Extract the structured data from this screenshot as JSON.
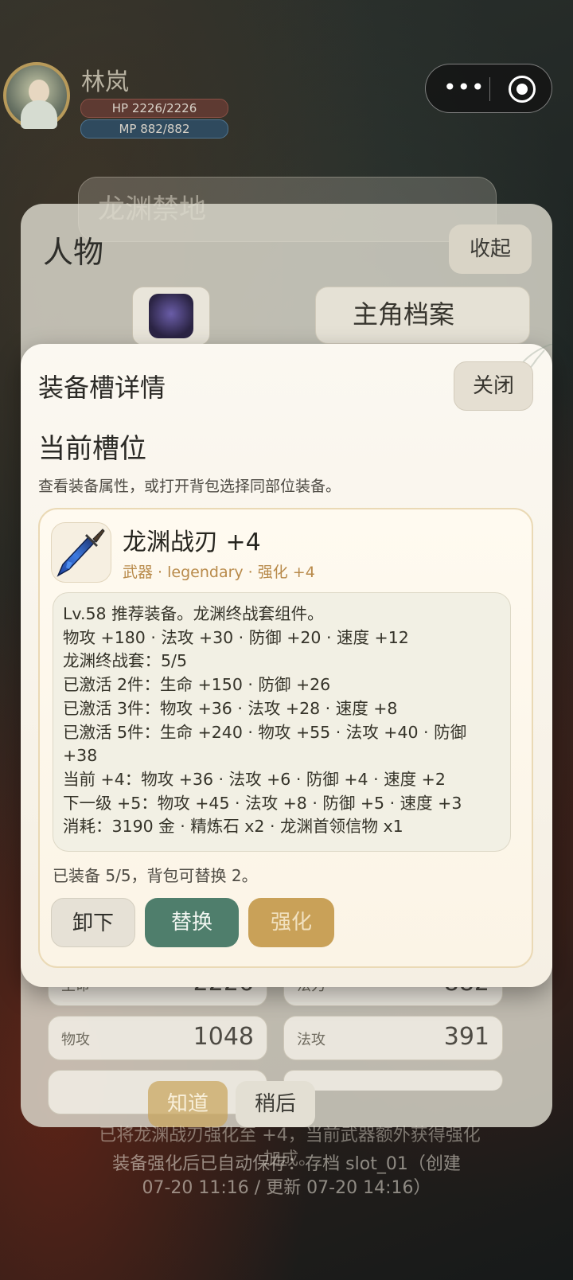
{
  "player": {
    "name": "林岚",
    "hp_text": "HP 2226/2226",
    "mp_text": "MP 882/882"
  },
  "capsule": {
    "more_icon": "more-dots-icon",
    "target_icon": "target-icon",
    "more_label": "•••"
  },
  "background_card": {
    "text": "龙渊禁地"
  },
  "character_panel": {
    "title": "人物",
    "collapse_label": "收起",
    "profile_label": "主角档案",
    "stats": [
      {
        "key": "生命",
        "value": "2226"
      },
      {
        "key": "法力",
        "value": "882"
      },
      {
        "key": "物攻",
        "value": "1048"
      },
      {
        "key": "法攻",
        "value": "391"
      }
    ]
  },
  "toast": {
    "confirm_label": "知道",
    "later_label": "稍后",
    "line1": "已将龙渊战刃强化至 +4，当前武器额外获得强化加成。",
    "line2": "装备强化后已自动保存：存档 slot_01（创建 07-20 11:16 / 更新 07-20 14:16）"
  },
  "modal": {
    "title": "装备槽详情",
    "close_label": "关闭",
    "section_title": "当前槽位",
    "section_desc": "查看装备属性，或打开背包选择同部位装备。",
    "item": {
      "name": "龙渊战刃 +4",
      "meta": "武器 · legendary · 强化 +4",
      "details": [
        "Lv.58 推荐装备。龙渊终战套组件。",
        "物攻 +180 · 法攻 +30 · 防御 +20 · 速度 +12",
        "龙渊终战套：5/5",
        "已激活 2件：生命 +150 · 防御 +26",
        "已激活 3件：物攻 +36 · 法攻 +28 · 速度 +8",
        "已激活 5件：生命 +240 · 物攻 +55 · 法攻 +40 · 防御 +38",
        "当前 +4：物攻 +36 · 法攻 +6 · 防御 +4 · 速度 +2",
        "下一级 +5：物攻 +45 · 法攻 +8 · 防御 +5 · 速度 +3",
        "消耗：3190 金 · 精炼石 x2 · 龙渊首领信物 x1"
      ]
    },
    "equip_status": "已装备 5/5，背包可替换 2。",
    "buttons": {
      "unequip": "卸下",
      "replace": "替换",
      "upgrade": "强化"
    }
  },
  "colors": {
    "accent_green": "#4f7e6c",
    "accent_gold": "#c9a158",
    "legendary": "#b88a4a"
  }
}
